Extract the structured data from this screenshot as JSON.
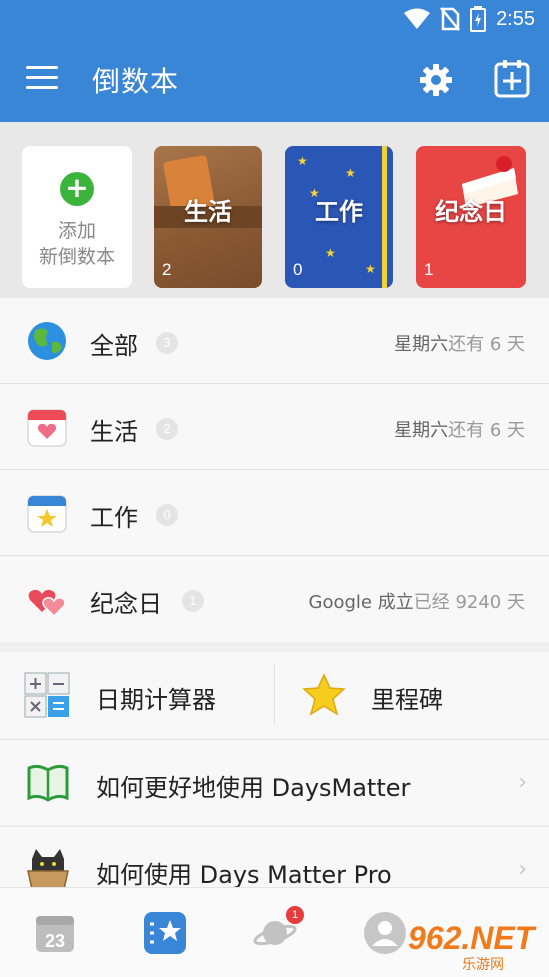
{
  "status_bar": {
    "time": "2:55"
  },
  "app_bar": {
    "title": "倒数本"
  },
  "books": {
    "add": {
      "line1": "添加",
      "line2": "新倒数本"
    },
    "items": [
      {
        "label": "生活",
        "count": "2"
      },
      {
        "label": "工作",
        "count": "0"
      },
      {
        "label": "纪念日",
        "count": "1"
      }
    ]
  },
  "categories": [
    {
      "name": "全部",
      "badge": "3",
      "info_main": "星期六",
      "info_muted": "还有 6 天"
    },
    {
      "name": "生活",
      "badge": "2",
      "info_main": "星期六",
      "info_muted": "还有 6 天"
    },
    {
      "name": "工作",
      "badge": "0",
      "info_main": "",
      "info_muted": ""
    },
    {
      "name": "纪念日",
      "badge": "1",
      "info_main": "Google 成立",
      "info_muted": "已经 9240 天"
    }
  ],
  "tools": {
    "calculator": "日期计算器",
    "milestone": "里程碑"
  },
  "help": [
    {
      "text": "如何更好地使用 DaysMatter"
    },
    {
      "text": "如何使用 Days Matter Pro"
    }
  ],
  "tabbar": {
    "calendar_day": "23",
    "notification_count": "1"
  },
  "watermark": {
    "main": "962.NET",
    "sub": "乐游网"
  },
  "colors": {
    "primary": "#3a86d6",
    "life": "#8a5a34",
    "work": "#2a56b5",
    "anniversary": "#e84545"
  }
}
